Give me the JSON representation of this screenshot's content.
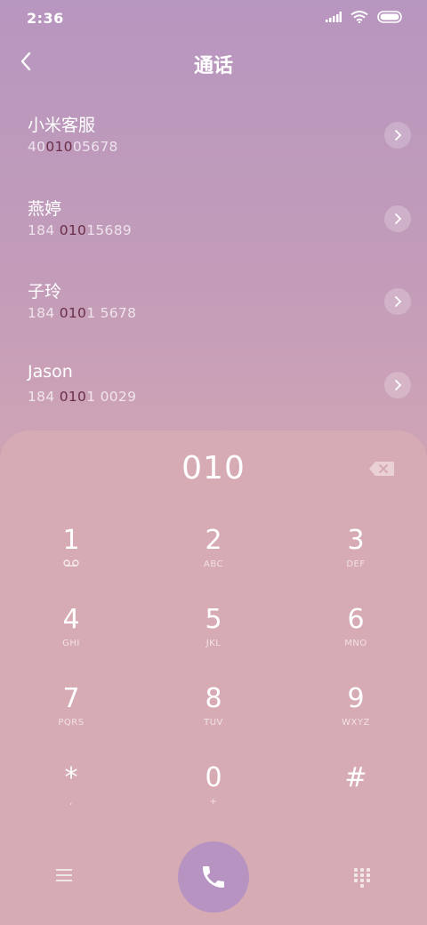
{
  "status_bar": {
    "time": "2:36"
  },
  "header": {
    "title": "通话"
  },
  "contacts": [
    {
      "name": "小米客服",
      "number_pre": "40",
      "number_match": "010",
      "number_post": "05678"
    },
    {
      "name": "燕婷",
      "number_pre": "184 ",
      "number_match": "010",
      "number_post": "15689"
    },
    {
      "name": "子玲",
      "number_pre": "184 ",
      "number_match": "010",
      "number_post": "1 5678"
    },
    {
      "name": "Jason",
      "number_pre": "184 ",
      "number_match": "010",
      "number_post": "1 0029"
    }
  ],
  "dialer": {
    "number": "010",
    "keys": [
      {
        "digit": "1",
        "sub": ""
      },
      {
        "digit": "2",
        "sub": "ABC"
      },
      {
        "digit": "3",
        "sub": "DEF"
      },
      {
        "digit": "4",
        "sub": "GHI"
      },
      {
        "digit": "5",
        "sub": "JKL"
      },
      {
        "digit": "6",
        "sub": "MNO"
      },
      {
        "digit": "7",
        "sub": "PQRS"
      },
      {
        "digit": "8",
        "sub": "TUV"
      },
      {
        "digit": "9",
        "sub": "WXYZ"
      },
      {
        "digit": "*",
        "sub": ","
      },
      {
        "digit": "0",
        "sub": "+"
      },
      {
        "digit": "#",
        "sub": ""
      }
    ]
  },
  "icons": {
    "back": "back-chevron-icon",
    "backspace": "backspace-icon",
    "voicemail": "voicemail-icon",
    "menu": "menu-icon",
    "call": "phone-icon",
    "dialpad": "dialpad-icon"
  },
  "colors": {
    "match_highlight": "#6a2e48",
    "call_button": "#b793c1",
    "panel": "#d7abb4"
  }
}
